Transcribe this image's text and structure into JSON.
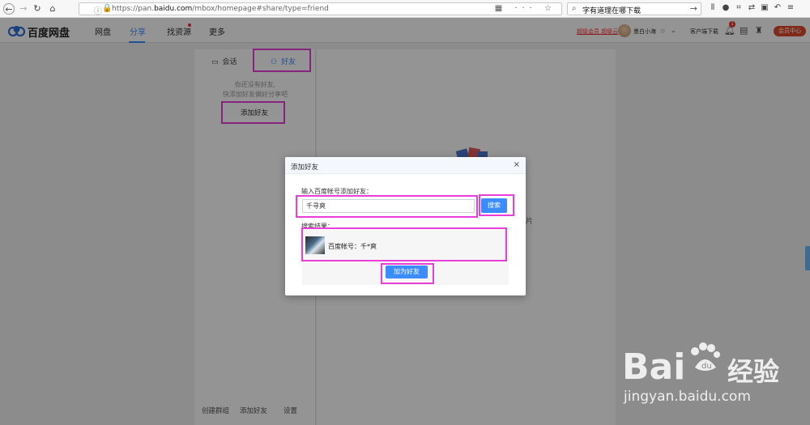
{
  "browser": {
    "url_prefix": "https://pan.",
    "url_domain": "baidu.com",
    "url_path": "/mbox/homepage#share/type=friend",
    "search_text": "字有道理在哪下载"
  },
  "header": {
    "logo_text": "百度网盘",
    "nav": [
      "网盘",
      "分享",
      "找资源",
      "更多"
    ],
    "active_nav": "分享",
    "vip_links": "超级会员  超级云",
    "username": "墨白小海",
    "client_download": "客户端下载",
    "notification_count": "1",
    "member_center": "会员中心"
  },
  "left_panel": {
    "tabs": [
      "会话",
      "好友"
    ],
    "active_tab": "好友",
    "empty_line1": "你还没有好友,",
    "empty_line2": "快添加好友偏好分享吧",
    "add_friend": "添加好友",
    "bottom_links": [
      "创建群组",
      "添加好友",
      "设置"
    ]
  },
  "main": {
    "ghost_text": "片"
  },
  "dialog": {
    "title": "添加好友",
    "close": "×",
    "input_label": "输入百度帐号添加好友：",
    "input_value": "千寻爽",
    "search_button": "搜索",
    "result_label": "搜索结果：",
    "result_text": "百度帐号：千*爽",
    "add_button": "加为好友"
  },
  "watermark": {
    "brand": "Bai",
    "brand_suffix": "经验",
    "domain": "jingyan.baidu.com"
  },
  "colors": {
    "accent": "#3b8cff",
    "highlight": "#e83fd8",
    "member": "#e0492c"
  }
}
